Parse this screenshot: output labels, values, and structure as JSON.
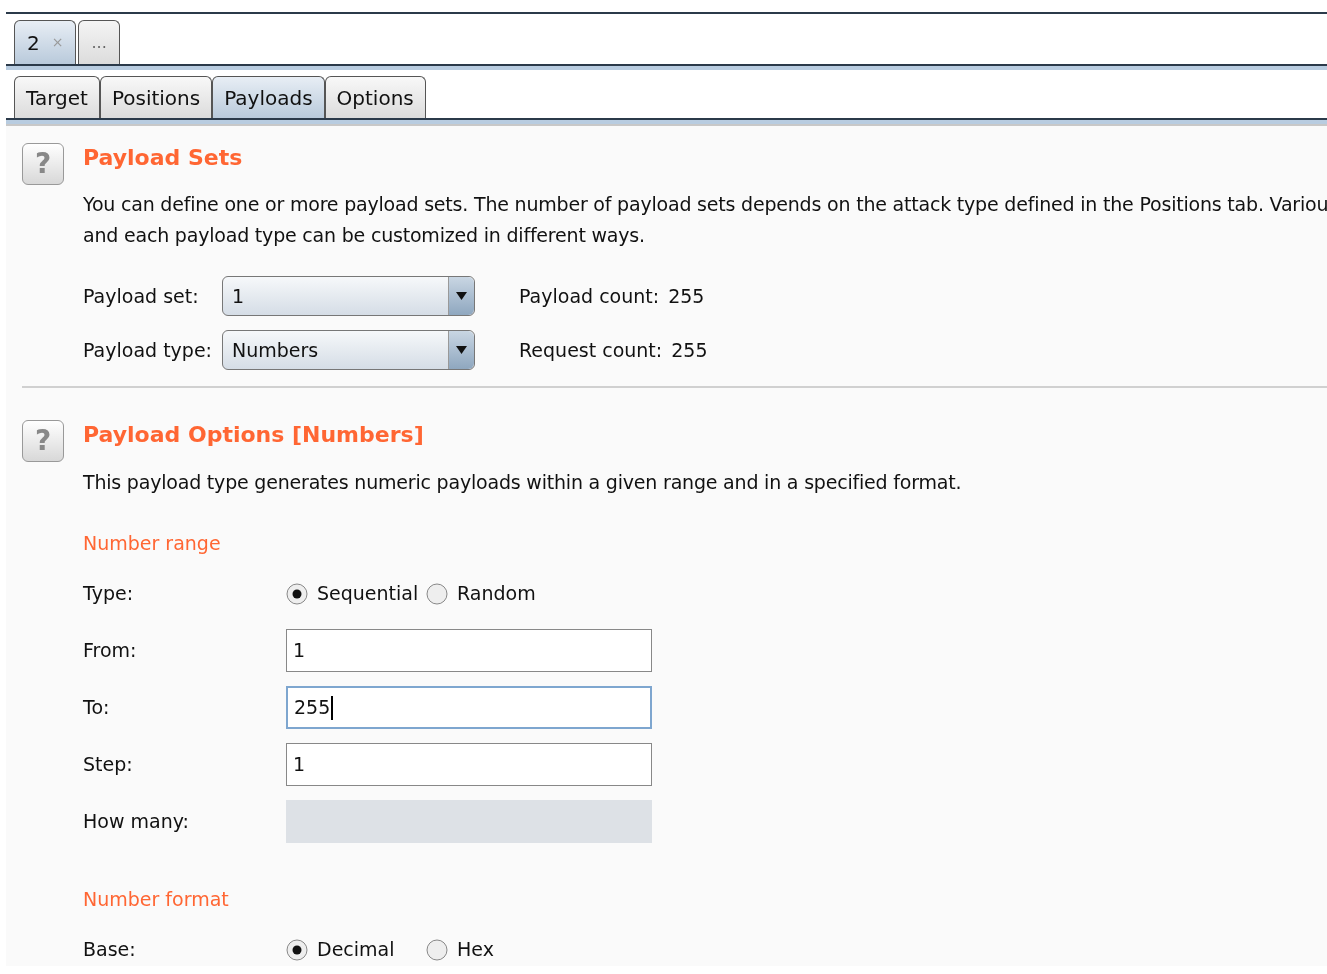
{
  "request_tabs": [
    {
      "label": "2",
      "close": "×",
      "selected": true
    },
    {
      "label": "...",
      "selected": false
    }
  ],
  "tabs": [
    {
      "label": "Target",
      "selected": false
    },
    {
      "label": "Positions",
      "selected": false
    },
    {
      "label": "Payloads",
      "selected": true
    },
    {
      "label": "Options",
      "selected": false
    }
  ],
  "payload_sets": {
    "help": "?",
    "title": "Payload Sets",
    "description": [
      "You can define one or more payload sets. The number of payload sets depends on the attack type defined in the Positions tab. Variou",
      "and each payload type can be customized in different ways."
    ],
    "rows": [
      {
        "label": "Payload set:",
        "value": "1",
        "count_label": "Payload count:",
        "count": "255"
      },
      {
        "label": "Payload type:",
        "value": "Numbers",
        "count_label": "Request count:",
        "count": "255"
      }
    ]
  },
  "payload_options": {
    "help": "?",
    "title": "Payload Options [Numbers]",
    "description": "This payload type generates numeric payloads within a given range and in a specified format.",
    "groups": [
      {
        "heading": "Number range",
        "rows": [
          {
            "kind": "radio",
            "label": "Type:",
            "options": [
              {
                "label": "Sequential",
                "selected": true
              },
              {
                "label": "Random",
                "selected": false
              }
            ]
          },
          {
            "kind": "field",
            "label": "From:",
            "value": "1",
            "focused": false,
            "disabled": false
          },
          {
            "kind": "field",
            "label": "To:",
            "value": "255",
            "focused": true,
            "disabled": false
          },
          {
            "kind": "field",
            "label": "Step:",
            "value": "1",
            "focused": false,
            "disabled": false
          },
          {
            "kind": "field",
            "label": "How many:",
            "focused": false,
            "disabled": true
          }
        ]
      },
      {
        "heading": "Number format",
        "rows": [
          {
            "kind": "radio",
            "label": "Base:",
            "options": [
              {
                "label": "Decimal",
                "selected": true
              },
              {
                "label": "Hex",
                "selected": false
              }
            ]
          }
        ]
      }
    ]
  }
}
